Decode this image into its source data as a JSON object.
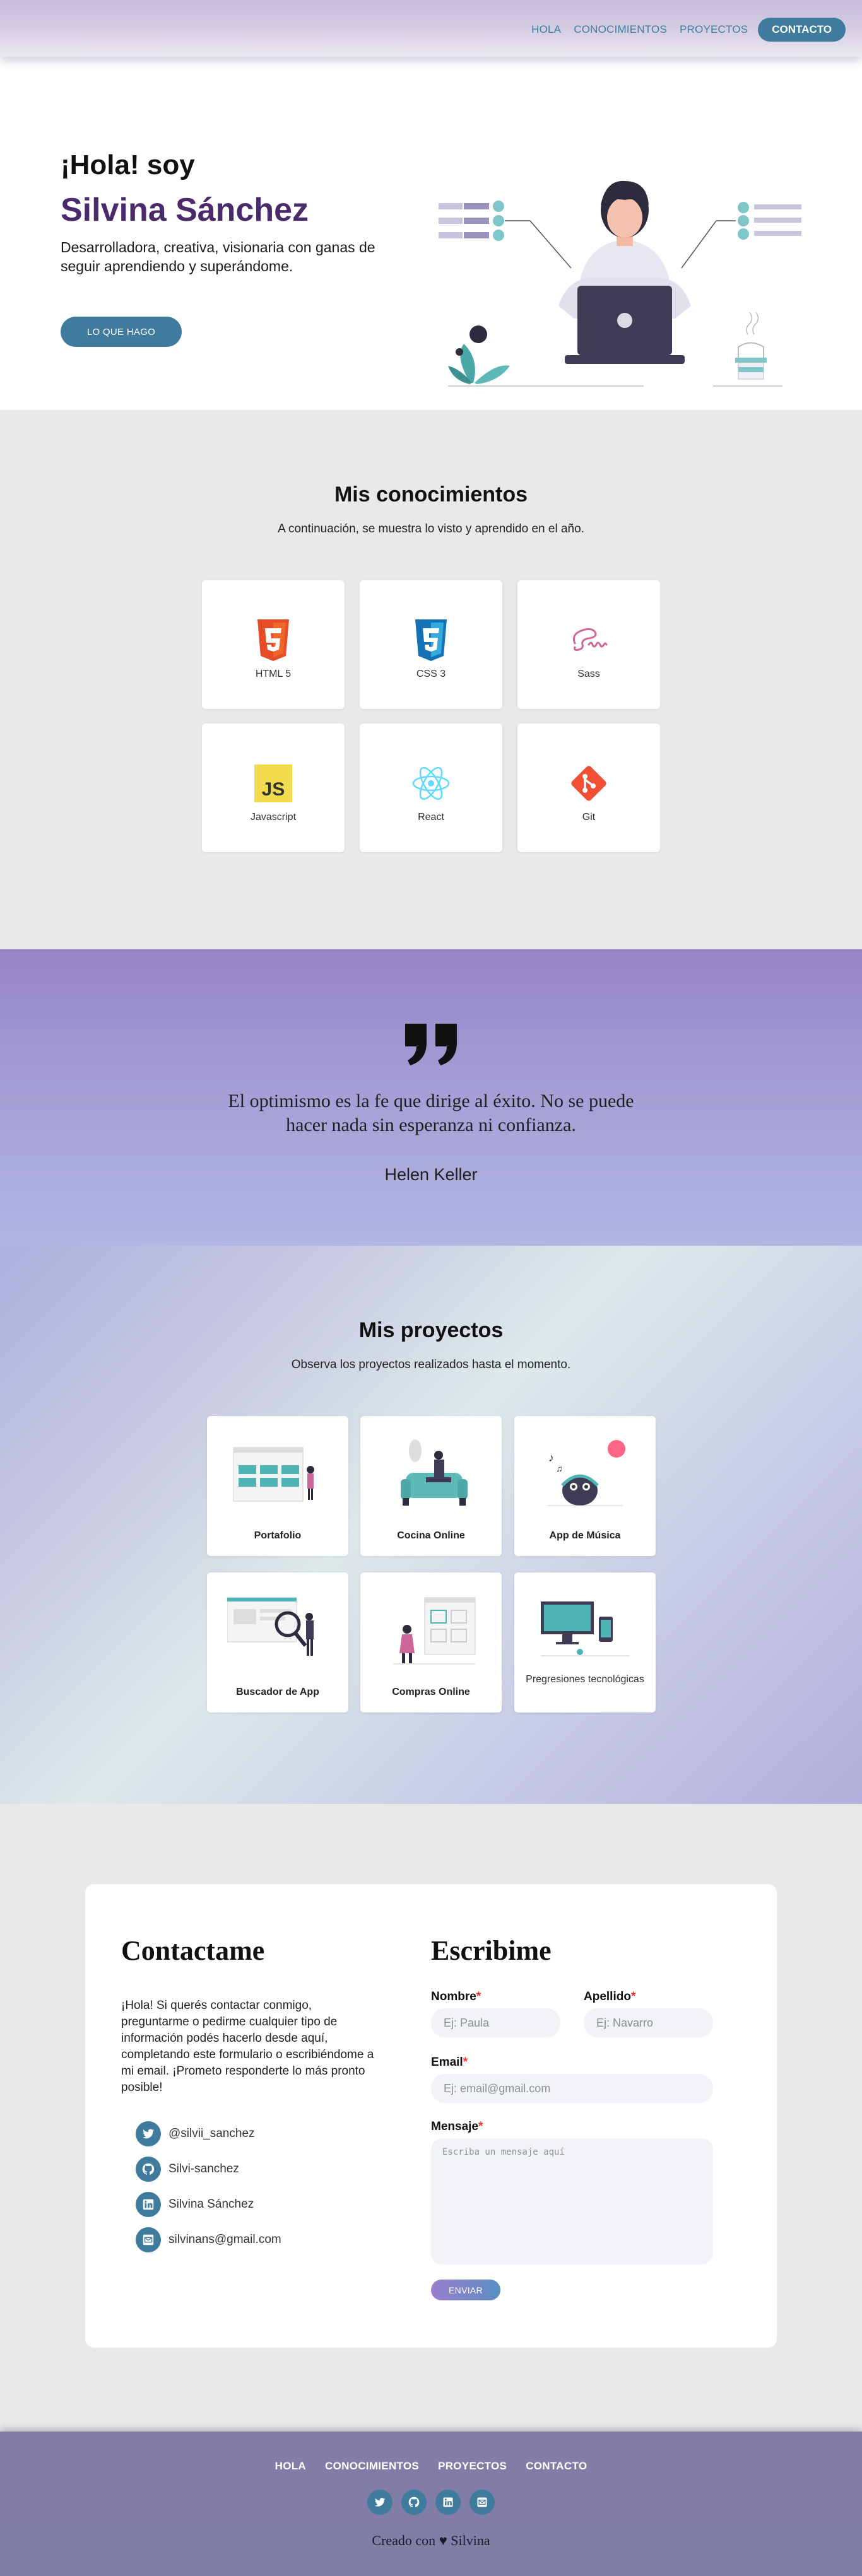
{
  "nav": {
    "links": [
      "HOLA",
      "CONOCIMIENTOS",
      "PROYECTOS"
    ],
    "cta": "CONTACTO"
  },
  "hero": {
    "greeting": "¡Hola! soy",
    "name": "Silvina Sánchez",
    "description": "Desarrolladora, creativa, visionaria con ganas de seguir aprendiendo y superándome.",
    "button": "LO QUE HAGO"
  },
  "skills": {
    "title": "Mis conocimientos",
    "subtitle": "A continuación, se muestra lo visto y aprendido en el año.",
    "items": [
      {
        "label": "HTML 5",
        "icon": "html5-icon"
      },
      {
        "label": "CSS 3",
        "icon": "css3-icon"
      },
      {
        "label": "Sass",
        "icon": "sass-icon"
      },
      {
        "label": "Javascript",
        "icon": "javascript-icon"
      },
      {
        "label": "React",
        "icon": "react-icon"
      },
      {
        "label": "Git",
        "icon": "git-icon"
      }
    ]
  },
  "quote": {
    "text": "El optimismo es la fe que dirige al éxito. No se puede hacer nada sin esperanza ni confianza.",
    "author": "Helen Keller"
  },
  "projects": {
    "title": "Mis proyectos",
    "subtitle": "Observa los proyectos realizados hasta el momento.",
    "items": [
      {
        "label": "Portafolio"
      },
      {
        "label": "Cocina Online"
      },
      {
        "label": "App de Música"
      },
      {
        "label": "Buscador de App"
      },
      {
        "label": "Compras Online"
      },
      {
        "label": "Pregresiones tecnológicas"
      }
    ]
  },
  "contact": {
    "title": "Contactame",
    "text": "¡Hola! Si querés contactar conmigo, preguntarme o pedirme cualquier tipo de información podés hacerlo desde aquí, completando este formulario o escribiéndome a mi email. ¡Prometo responderte lo más pronto posible!",
    "socials": [
      {
        "icon": "twitter-icon",
        "text": "@silvii_sanchez"
      },
      {
        "icon": "github-icon",
        "text": "Silvi-sanchez"
      },
      {
        "icon": "linkedin-icon",
        "text": "Silvina Sánchez"
      },
      {
        "icon": "email-icon",
        "text": "silvinans@gmail.com"
      }
    ],
    "form": {
      "title": "Escribime",
      "nombre_label": "Nombre",
      "nombre_placeholder": "Ej: Paula",
      "apellido_label": "Apellido",
      "apellido_placeholder": "Ej: Navarro",
      "email_label": "Email",
      "email_placeholder": "Ej: email@gmail.com",
      "mensaje_label": "Mensaje",
      "mensaje_placeholder": "Escriba un mensaje aquí",
      "required_mark": "*",
      "send": "ENVIAR"
    }
  },
  "footer": {
    "links": [
      "HOLA",
      "CONOCIMIENTOS",
      "PROYECTOS",
      "CONTACTO"
    ],
    "icons": [
      "twitter-icon",
      "github-icon",
      "linkedin-icon",
      "email-icon"
    ],
    "credit_prefix": "Creado con",
    "credit_heart": "♥",
    "credit_name": "Silvina"
  },
  "colors": {
    "accent": "#3e7b9c",
    "name_purple": "#4a2a6b",
    "quote_bg": "#9585c8"
  }
}
